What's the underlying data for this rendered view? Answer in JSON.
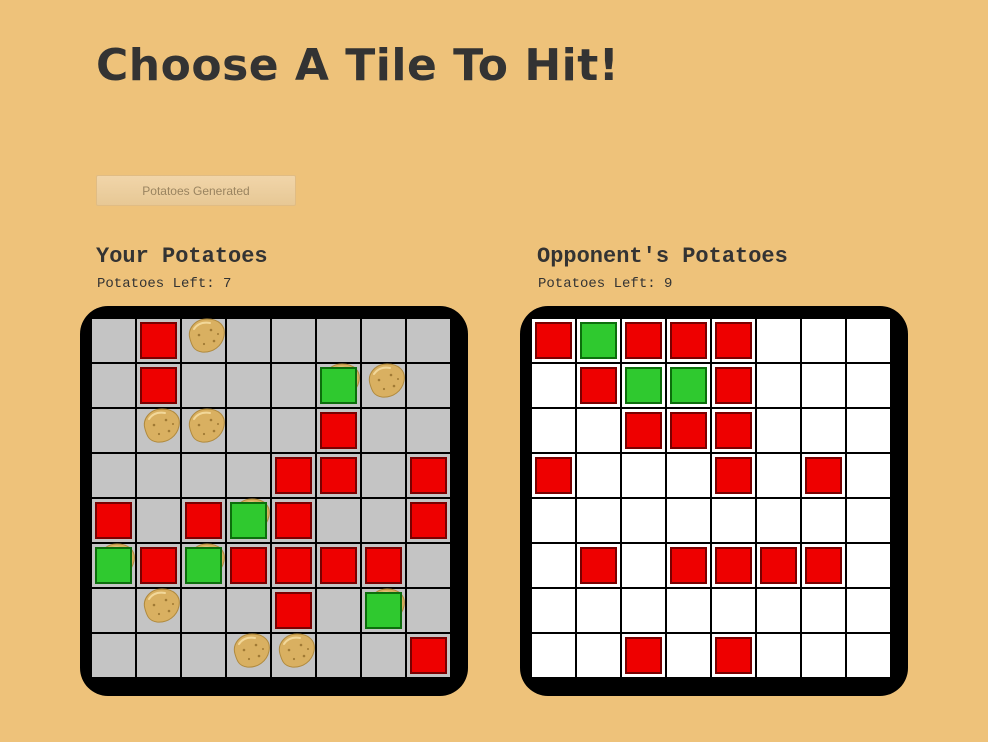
{
  "title": "Choose A Tile To Hit!",
  "status_button": "Potatoes Generated",
  "player": {
    "heading": "Your Potatoes",
    "left_label": "Potatoes Left: 7",
    "cells": [
      [
        "",
        "hit",
        "potato",
        "",
        "",
        "",
        "",
        ""
      ],
      [
        "",
        "hit",
        "",
        "",
        "",
        "potato-miss",
        "potato",
        ""
      ],
      [
        "",
        "potato",
        "potato",
        "",
        "",
        "hit",
        "",
        ""
      ],
      [
        "",
        "",
        "",
        "",
        "hit",
        "hit",
        "",
        "hit"
      ],
      [
        "hit",
        "",
        "hit",
        "potato-miss",
        "hit",
        "",
        "",
        "hit"
      ],
      [
        "potato-miss",
        "hit",
        "potato-miss",
        "hit",
        "hit",
        "hit",
        "hit",
        ""
      ],
      [
        "",
        "potato",
        "",
        "",
        "hit",
        "",
        "potato-miss",
        ""
      ],
      [
        "",
        "",
        "",
        "potato",
        "potato",
        "",
        "",
        "hit"
      ]
    ]
  },
  "opponent": {
    "heading": "Opponent's Potatoes",
    "left_label": "Potatoes Left: 9",
    "cells": [
      [
        "hit",
        "miss",
        "hit",
        "hit",
        "hit",
        "",
        "",
        ""
      ],
      [
        "",
        "hit",
        "miss",
        "miss",
        "hit",
        "",
        "",
        ""
      ],
      [
        "",
        "",
        "hit",
        "hit",
        "hit",
        "",
        "",
        ""
      ],
      [
        "hit",
        "",
        "",
        "",
        "hit",
        "",
        "hit",
        ""
      ],
      [
        "",
        "",
        "",
        "",
        "",
        "",
        "",
        ""
      ],
      [
        "",
        "hit",
        "",
        "hit",
        "hit",
        "hit",
        "hit",
        ""
      ],
      [
        "",
        "",
        "",
        "",
        "",
        "",
        "",
        ""
      ],
      [
        "",
        "",
        "hit",
        "",
        "hit",
        "",
        "",
        ""
      ]
    ]
  },
  "colors": {
    "background": "#eec27a",
    "hit": "#ee0000",
    "miss": "#2fc92f",
    "player_tile": "#c4c4c4",
    "opponent_tile": "#ffffff",
    "potato": "#d9b061"
  },
  "icons": {
    "potato": "potato-icon",
    "hit": "hit-marker",
    "miss": "miss-marker"
  }
}
